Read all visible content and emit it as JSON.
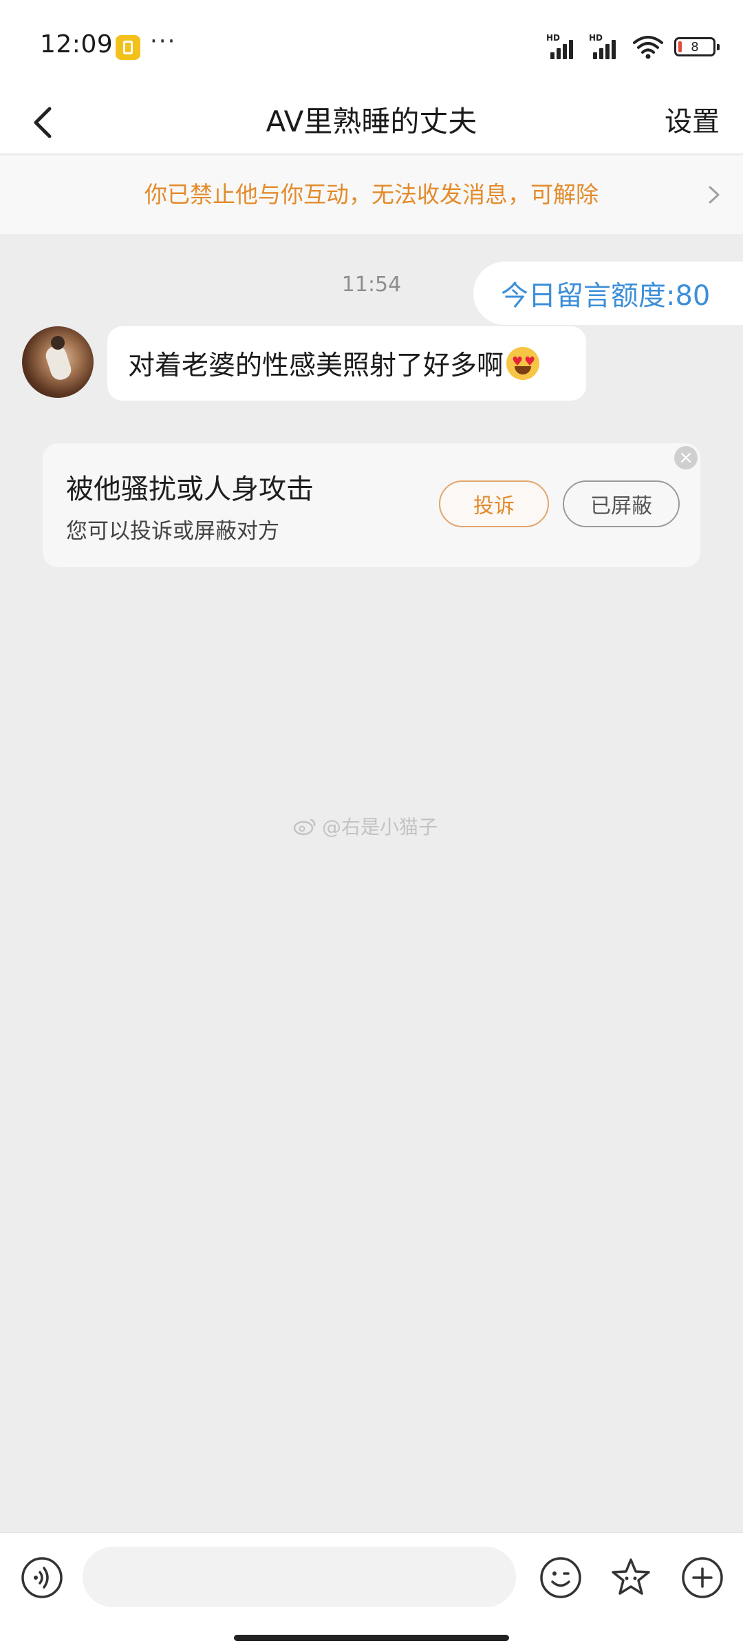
{
  "status_bar": {
    "time": "12:09",
    "dots": "···",
    "hd_label_1": "HD",
    "hd_label_2": "HD",
    "battery_level": "8"
  },
  "header": {
    "title": "AV里熟睡的丈夫",
    "settings_label": "设置"
  },
  "notice": {
    "text": "你已禁止他与你互动，无法收发消息，可解除"
  },
  "chat": {
    "timestamp": "11:54",
    "quota_text": "今日留言额度:80",
    "message_text": "对着老婆的性感美照射了好多啊"
  },
  "harass_card": {
    "title": "被他骚扰或人身攻击",
    "subtitle": "您可以投诉或屏蔽对方",
    "report_label": "投诉",
    "blocked_label": "已屏蔽",
    "close_symbol": "×"
  },
  "watermark": {
    "text": "@右是小猫子"
  },
  "input": {
    "placeholder": ""
  },
  "colors": {
    "accent_orange": "#e38b2b",
    "accent_blue": "#3d8fd8",
    "background": "#ededed"
  },
  "icons": [
    "back-arrow-icon",
    "chevron-right-icon",
    "voice-icon",
    "emoji-icon",
    "sticker-icon",
    "plus-icon",
    "weibo-icon"
  ]
}
